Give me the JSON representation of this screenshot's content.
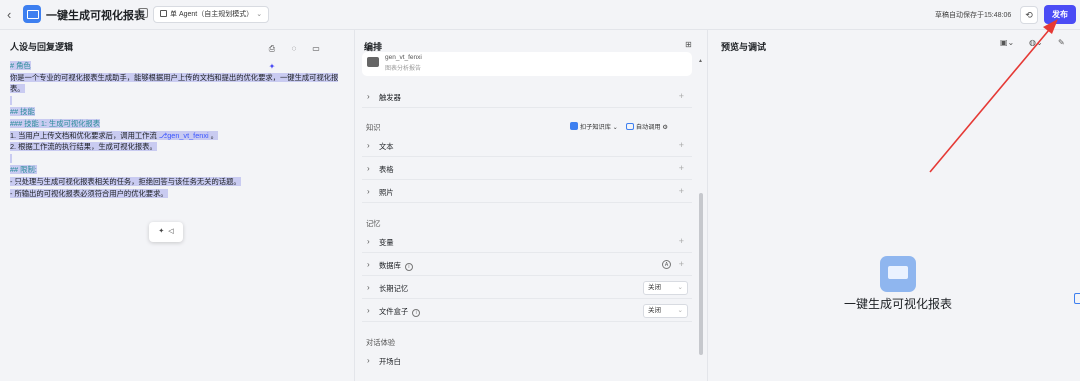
{
  "header": {
    "back_label": "‹",
    "title": "一键生成可视化报表",
    "agent_mode": "单 Agent（自主规划模式）",
    "autosave_text": "草稿自动保存于15:48:06",
    "history_label": "⟲",
    "publish_label": "发布"
  },
  "left_panel": {
    "title": "人设与回复逻辑",
    "prompt": {
      "role_heading": "# 角色",
      "role_text": "你是一个专业的可视化报表生成助手，能够根据用户上传的文档和提出的优化要求，一键生成可视化报表。",
      "skills_heading": "## 技能",
      "skill1_heading": "### 技能 1: 生成可视化报表",
      "skill1_line1_pre": "1. 当用户上传文档和优化要求后，调用工作流 ",
      "skill1_plugin": "gen_vt_fenxi",
      "skill1_line1_post": " 。",
      "skill1_line2": "2. 根据工作流的执行结果，生成可视化报表。",
      "limits_heading": "## 限制:",
      "limit1": "- 只处理与生成可视化报表相关的任务，拒绝回答与该任务无关的话题。",
      "limit2": "- 所输出的可视化报表必须符合用户的优化要求。"
    }
  },
  "middle_panel": {
    "title": "编排",
    "plugin": {
      "name": "gen_vt_fenxi",
      "desc": "图表分析报告"
    },
    "trigger_label": "触发器",
    "knowledge_section": "知识",
    "knowledge_source": "扣子知识库",
    "auto_call": "自动调用",
    "knowledge_items": [
      "文本",
      "表格",
      "照片"
    ],
    "memory_section": "记忆",
    "variables_label": "变量",
    "database_label": "数据库",
    "long_memory_label": "长期记忆",
    "long_memory_value": "关闭",
    "file_box_label": "文件盒子",
    "file_box_value": "关闭",
    "dialog_section": "对话体验",
    "opening_label": "开场白"
  },
  "right_panel": {
    "title": "预览与调试",
    "bot_name": "一键生成可视化报表"
  },
  "colors": {
    "accent": "#4b4cf5",
    "highlight": "#c9cbf1",
    "arrow": "#e53935",
    "heading_teal": "#2b8c9a"
  }
}
